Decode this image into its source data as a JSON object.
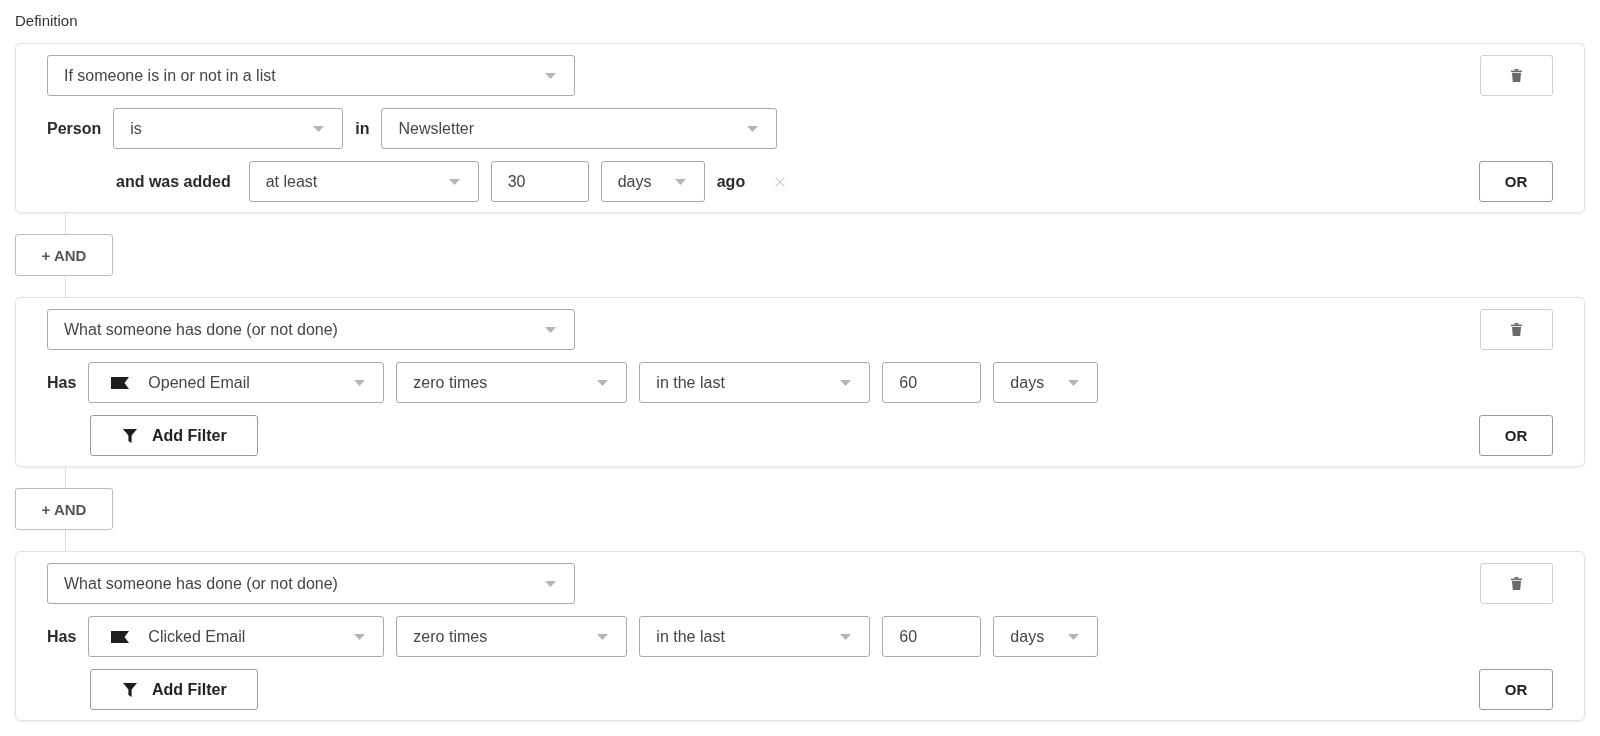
{
  "title": "Definition",
  "conditions": [
    {
      "kind": "list",
      "condition_type": "If someone is in or not in a list",
      "subject_label": "Person",
      "relation": "is",
      "preposition": "in",
      "list": "Newsletter",
      "timing": {
        "label": "and was added",
        "comparator": "at least",
        "amount": "30",
        "unit": "days",
        "suffix": "ago"
      },
      "or_button": "OR"
    },
    {
      "kind": "activity",
      "condition_type": "What someone has done (or not done)",
      "subject_label": "Has",
      "event": "Opened Email",
      "frequency": "zero times",
      "period": "in the last",
      "amount": "60",
      "unit": "days",
      "filter_button": "Add Filter",
      "or_button": "OR"
    },
    {
      "kind": "activity",
      "condition_type": "What someone has done (or not done)",
      "subject_label": "Has",
      "event": "Clicked Email",
      "frequency": "zero times",
      "period": "in the last",
      "amount": "60",
      "unit": "days",
      "filter_button": "Add Filter",
      "or_button": "OR"
    }
  ],
  "and_buttons": [
    "+ AND",
    "+ AND"
  ]
}
